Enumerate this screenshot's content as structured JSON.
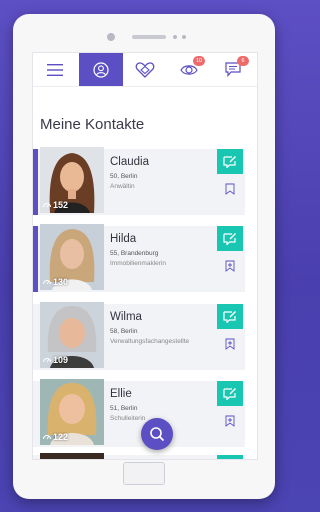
{
  "page": {
    "title": "Meine Kontakte"
  },
  "nav": {
    "tabs": [
      {
        "icon": "menu-icon"
      },
      {
        "icon": "profile-icon",
        "active": true
      },
      {
        "icon": "heart-icon"
      },
      {
        "icon": "eye-icon",
        "badge": "10"
      },
      {
        "icon": "chat-icon",
        "badge": "6"
      }
    ]
  },
  "contacts": [
    {
      "name": "Claudia",
      "meta": "50, Berlin",
      "job": "Anwältin",
      "views": "152"
    },
    {
      "name": "Hilda",
      "meta": "55, Brandenburg",
      "job": "Immobilienmaklerin",
      "views": "130"
    },
    {
      "name": "Wilma",
      "meta": "58, Berlin",
      "job": "Verwaltungsfachangestellte",
      "views": "109"
    },
    {
      "name": "Ellie",
      "meta": "51, Berlin",
      "job": "Schulleiterin",
      "views": "122"
    }
  ],
  "colors": {
    "accent": "#5b4fc3",
    "action": "#19c6b1",
    "badge": "#ef6a6a"
  }
}
